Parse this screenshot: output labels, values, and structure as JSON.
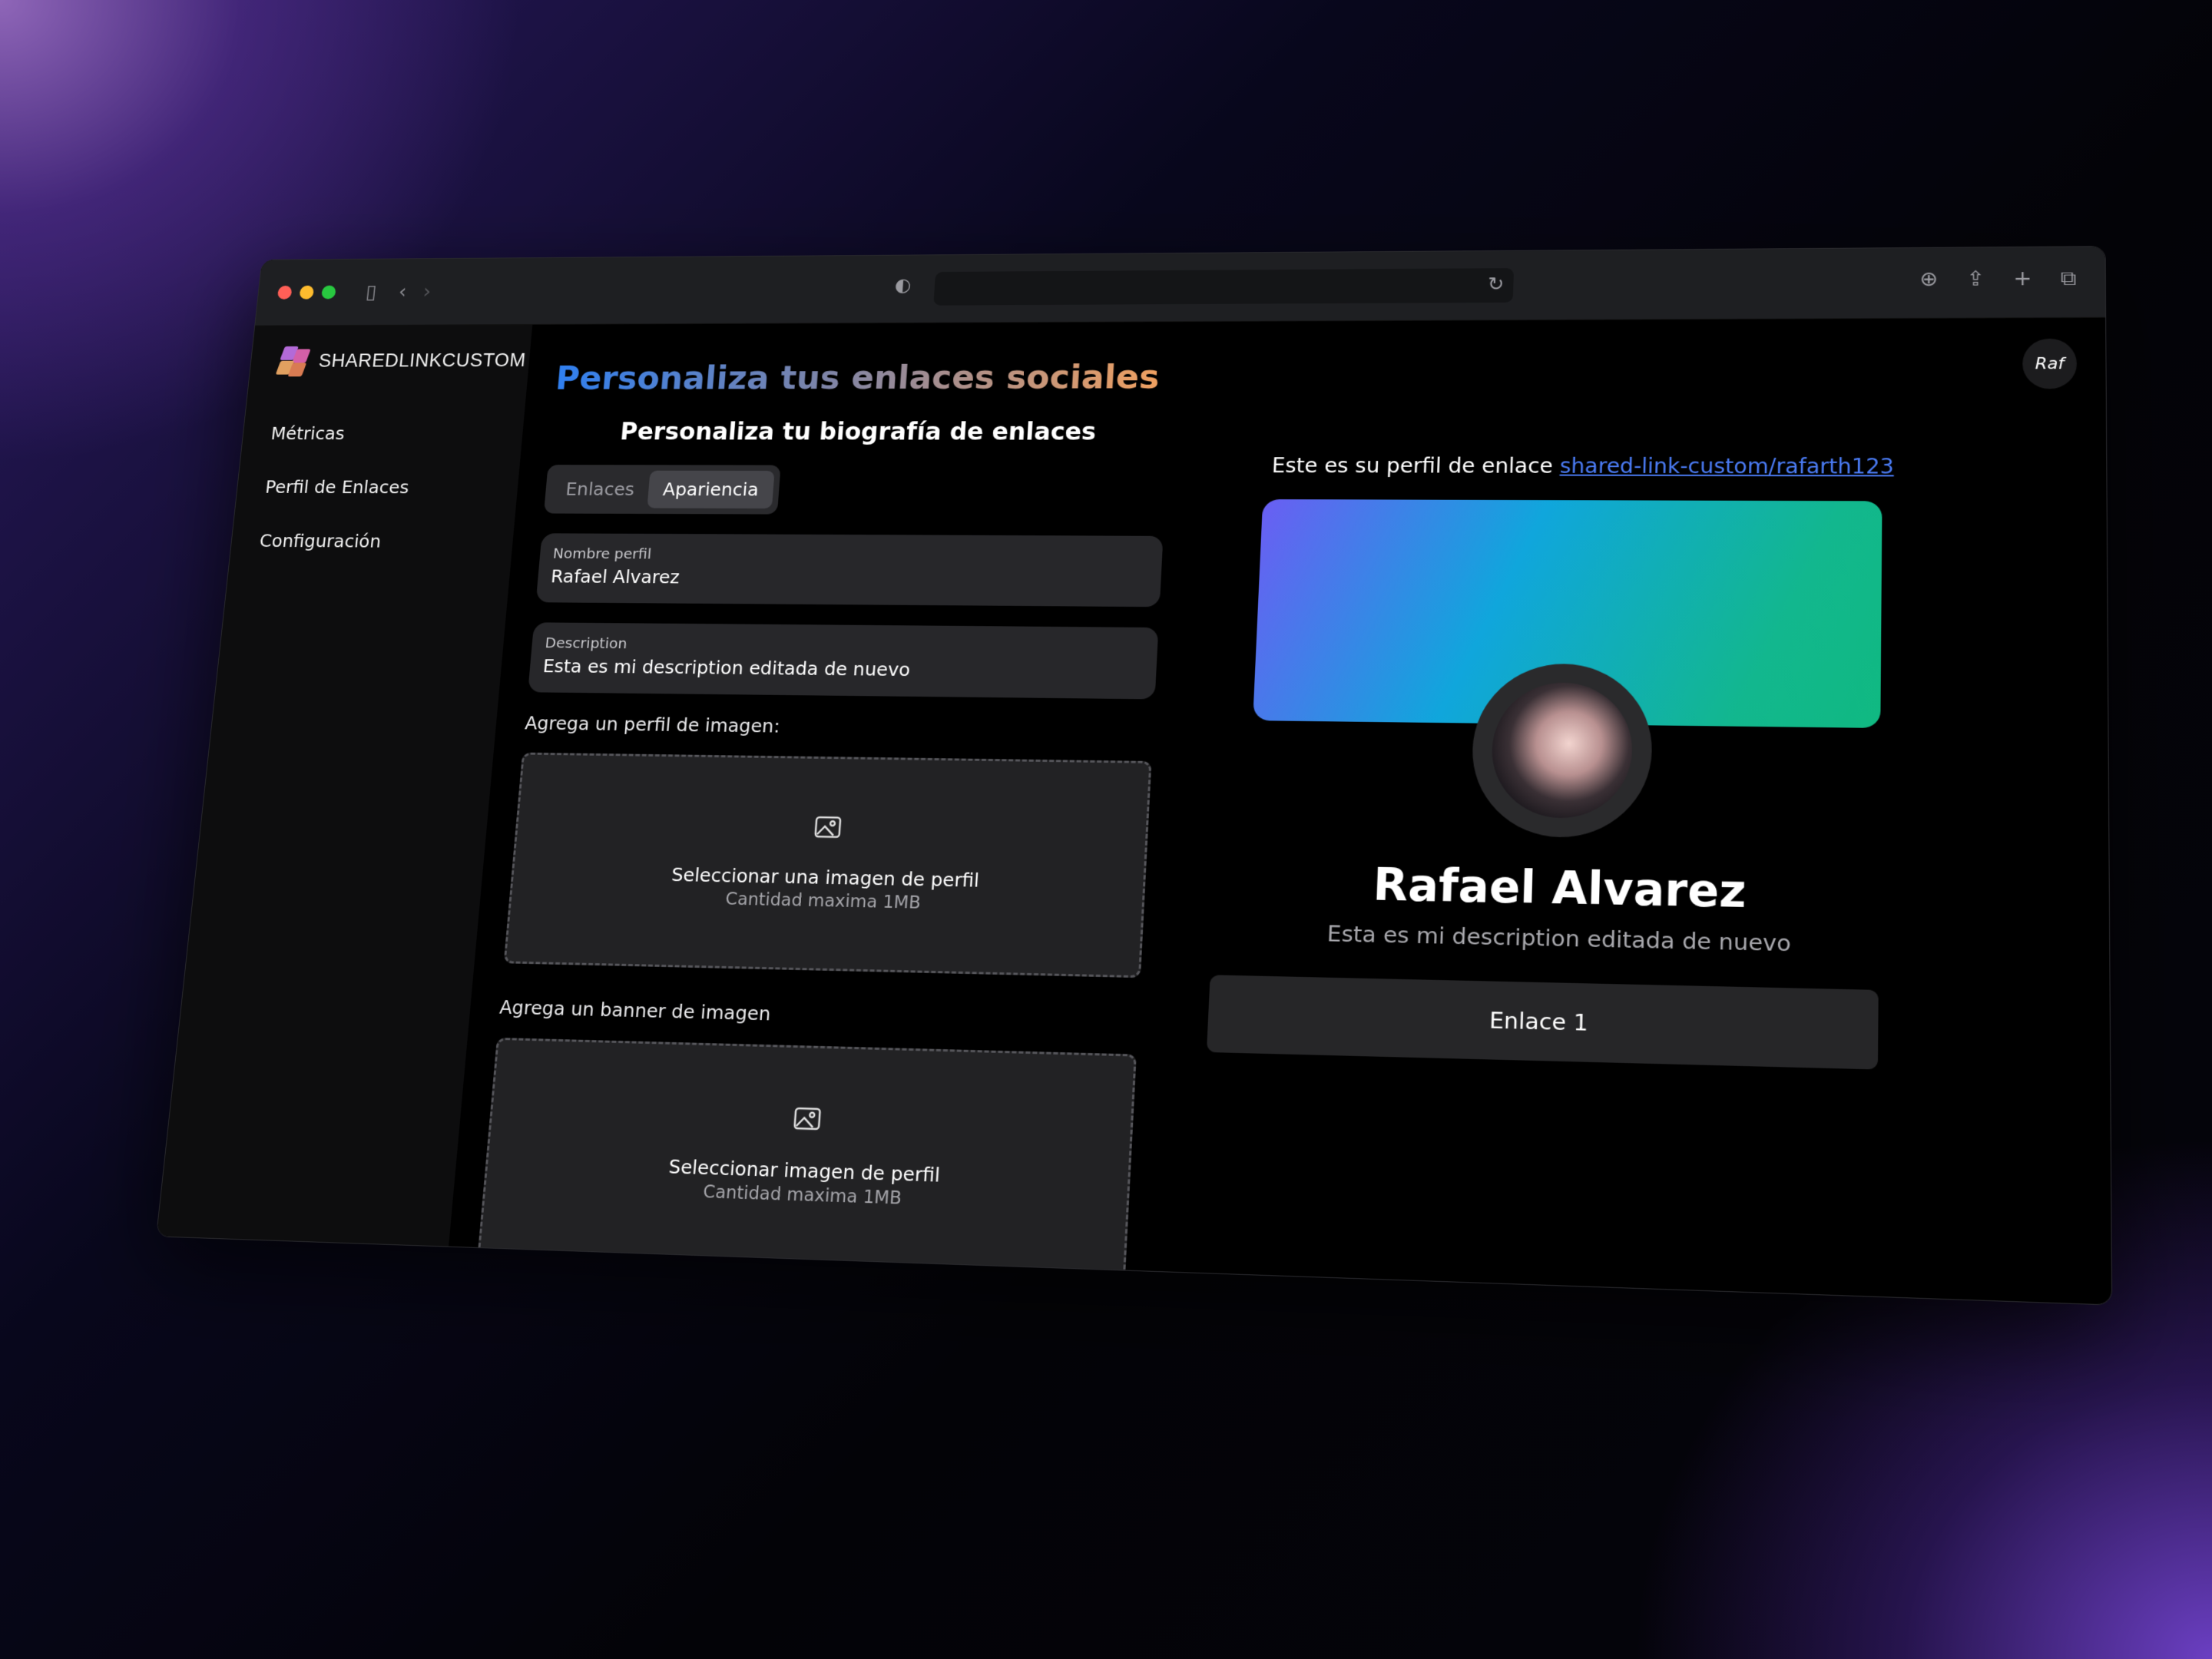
{
  "brand": {
    "name": "SHAREDLINKCUSTOM"
  },
  "sidebar": {
    "items": [
      {
        "label": "Métricas"
      },
      {
        "label": "Perfil de Enlaces"
      },
      {
        "label": "Configuración"
      }
    ]
  },
  "header": {
    "user_initials": "Raf"
  },
  "main": {
    "title": "Personaliza tus enlaces sociales",
    "subtitle": "Personaliza tu biografía de enlaces",
    "tabs": [
      {
        "label": "Enlaces",
        "active": false
      },
      {
        "label": "Apariencia",
        "active": true
      }
    ],
    "fields": {
      "profile_name": {
        "label": "Nombre perfil",
        "value": "Rafael Alvarez"
      },
      "description": {
        "label": "Description",
        "value": "Esta es mi description editada de nuevo"
      }
    },
    "profile_image": {
      "section_label": "Agrega un perfil de imagen:",
      "title": "Seleccionar una imagen de perfil",
      "subtitle": "Cantidad maxima 1MB"
    },
    "banner_image": {
      "section_label": "Agrega un banner de imagen",
      "title": "Seleccionar imagen de perfil",
      "subtitle": "Cantidad maxima 1MB"
    }
  },
  "preview": {
    "intro": "Este es su perfil de enlace",
    "link": "shared-link-custom/rafarth123",
    "name": "Rafael Alvarez",
    "description": "Esta es mi description editada de nuevo",
    "links": [
      {
        "label": "Enlace 1"
      }
    ]
  },
  "colors": {
    "accent_link": "#4b7cf6",
    "banner_gradient": [
      "#6a5ef3",
      "#10a6dc",
      "#10b981"
    ],
    "title_gradient": [
      "#2f7ff0",
      "#f0a060"
    ]
  },
  "icons": {
    "titlebar": [
      "sidebar-toggle-icon",
      "back-icon",
      "forward-icon",
      "shield-icon",
      "reload-icon",
      "download-icon",
      "share-icon",
      "plus-icon",
      "tabs-icon"
    ],
    "dropzone": "image-icon"
  }
}
